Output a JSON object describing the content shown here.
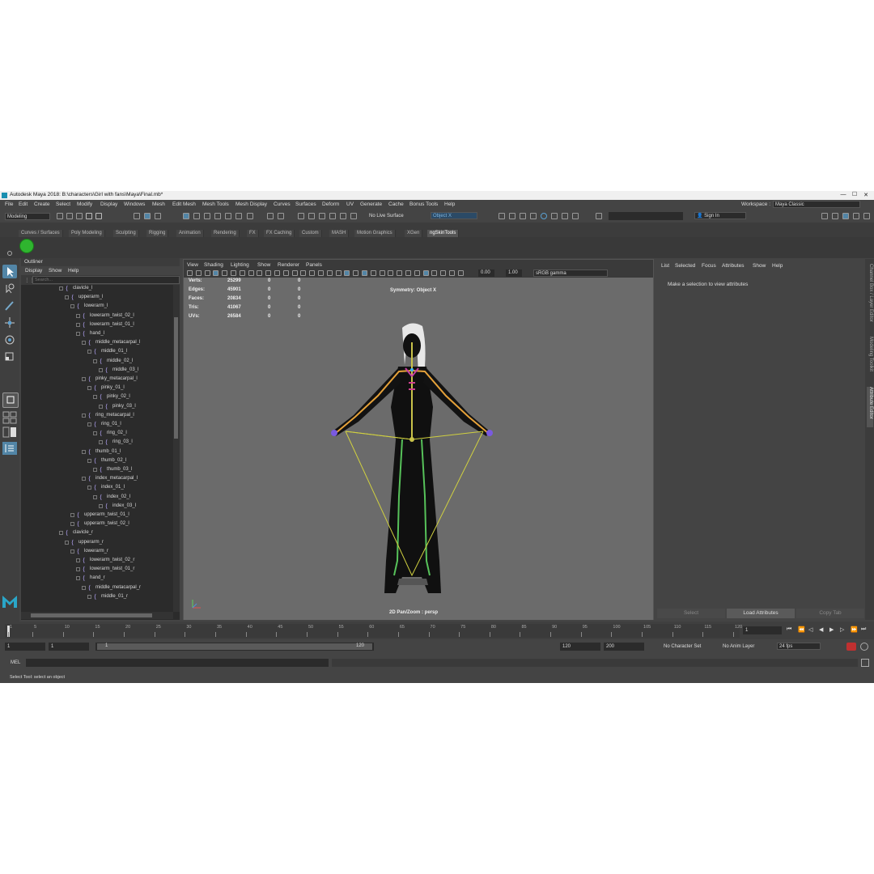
{
  "window": {
    "title": "Autodesk Maya 2018: B:\\characters\\Girl with fans\\Maya\\Final.mb*",
    "min": "—",
    "max": "☐",
    "close": "✕"
  },
  "menu": [
    "File",
    "Edit",
    "Create",
    "Select",
    "Modify",
    "Display",
    "Windows",
    "Mesh",
    "Edit Mesh",
    "Mesh Tools",
    "Mesh Display",
    "Curves",
    "Surfaces",
    "Deform",
    "UV",
    "Generate",
    "Cache",
    "Bonus Tools",
    "Help"
  ],
  "workspace": {
    "label": "Workspace :",
    "value": "Maya Classic"
  },
  "status": {
    "mode": "Modeling",
    "live_surface": "No Live Surface",
    "symmetry_field": "Object X",
    "sign_in": "Sign In"
  },
  "shelf_tabs": [
    "Curves / Surfaces",
    "Poly Modeling",
    "Sculpting",
    "Rigging",
    "Animation",
    "Rendering",
    "FX",
    "FX Caching",
    "Custom",
    "MASH",
    "Motion Graphics",
    "XGen",
    "ngSkinTools"
  ],
  "outliner": {
    "title": "Outliner",
    "menu": [
      "Display",
      "Show",
      "Help"
    ],
    "search_placeholder": "Search...",
    "items": [
      {
        "label": "clavicle_l",
        "depth": 0
      },
      {
        "label": "upperarm_l",
        "depth": 1
      },
      {
        "label": "lowerarm_l",
        "depth": 2
      },
      {
        "label": "lowerarm_twist_02_l",
        "depth": 3
      },
      {
        "label": "lowerarm_twist_01_l",
        "depth": 3
      },
      {
        "label": "hand_l",
        "depth": 3
      },
      {
        "label": "middle_metacarpal_l",
        "depth": 4
      },
      {
        "label": "middle_01_l",
        "depth": 5
      },
      {
        "label": "middle_02_l",
        "depth": 6
      },
      {
        "label": "middle_03_l",
        "depth": 7
      },
      {
        "label": "pinky_metacarpal_l",
        "depth": 4
      },
      {
        "label": "pinky_01_l",
        "depth": 5
      },
      {
        "label": "pinky_02_l",
        "depth": 6
      },
      {
        "label": "pinky_03_l",
        "depth": 7
      },
      {
        "label": "ring_metacarpal_l",
        "depth": 4
      },
      {
        "label": "ring_01_l",
        "depth": 5
      },
      {
        "label": "ring_02_l",
        "depth": 6
      },
      {
        "label": "ring_03_l",
        "depth": 7
      },
      {
        "label": "thumb_01_l",
        "depth": 4
      },
      {
        "label": "thumb_02_l",
        "depth": 5
      },
      {
        "label": "thumb_03_l",
        "depth": 6
      },
      {
        "label": "index_metacarpal_l",
        "depth": 4
      },
      {
        "label": "index_01_l",
        "depth": 5
      },
      {
        "label": "index_02_l",
        "depth": 6
      },
      {
        "label": "index_03_l",
        "depth": 7
      },
      {
        "label": "upperarm_twist_01_l",
        "depth": 2
      },
      {
        "label": "upperarm_twist_02_l",
        "depth": 2
      },
      {
        "label": "clavicle_r",
        "depth": 0
      },
      {
        "label": "upperarm_r",
        "depth": 1
      },
      {
        "label": "lowerarm_r",
        "depth": 2
      },
      {
        "label": "lowerarm_twist_02_r",
        "depth": 3
      },
      {
        "label": "lowerarm_twist_01_r",
        "depth": 3
      },
      {
        "label": "hand_r",
        "depth": 3
      },
      {
        "label": "middle_metacarpal_r",
        "depth": 4
      },
      {
        "label": "middle_01_r",
        "depth": 5
      }
    ]
  },
  "viewport": {
    "menu": [
      "View",
      "Shading",
      "Lighting",
      "Show",
      "Renderer",
      "Panels"
    ],
    "exposure": "0.00",
    "gamma": "1.00",
    "color_space": "sRGB gamma",
    "hud": [
      {
        "label": "Verts:",
        "v1": "25299",
        "v2": "0",
        "v3": "0"
      },
      {
        "label": "Edges:",
        "v1": "45901",
        "v2": "0",
        "v3": "0"
      },
      {
        "label": "Faces:",
        "v1": "20834",
        "v2": "0",
        "v3": "0"
      },
      {
        "label": "Tris:",
        "v1": "41067",
        "v2": "0",
        "v3": "0"
      },
      {
        "label": "UVs:",
        "v1": "26584",
        "v2": "0",
        "v3": "0"
      }
    ],
    "symmetry": "Symmetry: Object X",
    "camera": "2D Pan/Zoom : persp"
  },
  "attribute_editor": {
    "menu": [
      "List",
      "Selected",
      "Focus",
      "Attributes",
      "Show",
      "Help"
    ],
    "message": "Make a selection to view attributes",
    "buttons": [
      "Select",
      "Load Attributes",
      "Copy Tab"
    ]
  },
  "right_tabs": [
    "Channel Box / Layer Editor",
    "Modeling Toolkit",
    "Attribute Editor"
  ],
  "timeline": {
    "ticks": [
      "1",
      "5",
      "10",
      "15",
      "20",
      "25",
      "30",
      "35",
      "40",
      "45",
      "50",
      "55",
      "60",
      "65",
      "70",
      "75",
      "80",
      "85",
      "90",
      "95",
      "100",
      "105",
      "110",
      "115",
      "120"
    ],
    "current_frame": "1"
  },
  "range": {
    "start": "1",
    "start2": "1",
    "slider_start": "1",
    "slider_end": "120",
    "end": "120",
    "end2": "200",
    "character_set": "No Character Set",
    "anim_layer": "No Anim Layer",
    "fps": "24 fps"
  },
  "command": {
    "label": "MEL"
  },
  "help_line": "Select Tool: select an object",
  "colors": {
    "accent": "#5285a6",
    "viewport_bg": "#6b6b6b",
    "panel": "#444444"
  }
}
